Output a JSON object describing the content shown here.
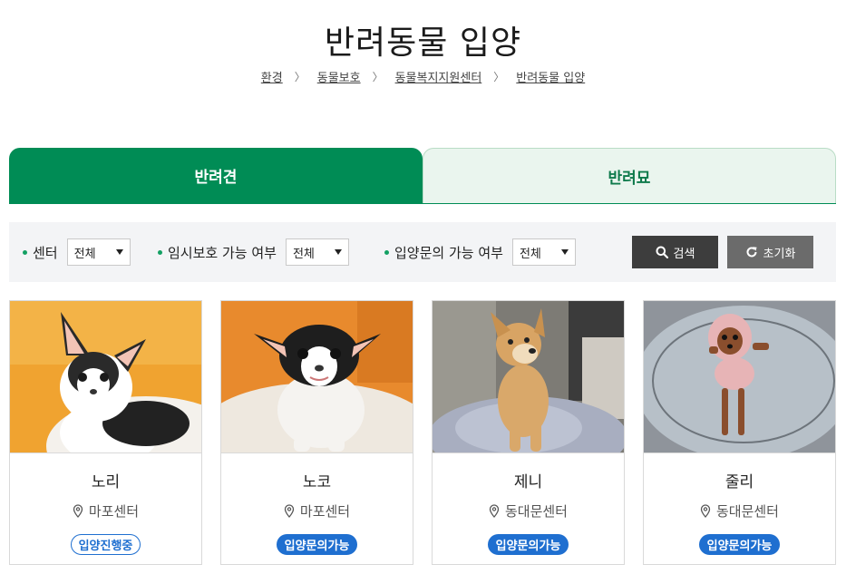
{
  "page": {
    "title": "반려동물 입양"
  },
  "breadcrumb": [
    "환경",
    "동물보호",
    "동물복지지원센터",
    "반려동물 입양"
  ],
  "tabs": [
    {
      "label": "반려견",
      "active": true
    },
    {
      "label": "반려묘",
      "active": false
    }
  ],
  "filters": [
    {
      "label": "센터",
      "value": "전체"
    },
    {
      "label": "임시보호 가능 여부",
      "value": "전체"
    },
    {
      "label": "입양문의 가능 여부",
      "value": "전체"
    }
  ],
  "buttons": {
    "search": "검색",
    "reset": "초기화"
  },
  "animals": [
    {
      "name": "노리",
      "center": "마포센터",
      "status": "입양진행중",
      "status_type": "ongoing"
    },
    {
      "name": "노코",
      "center": "마포센터",
      "status": "입양문의가능",
      "status_type": "available"
    },
    {
      "name": "제니",
      "center": "동대문센터",
      "status": "입양문의가능",
      "status_type": "available"
    },
    {
      "name": "줄리",
      "center": "동대문센터",
      "status": "입양문의가능",
      "status_type": "available"
    }
  ],
  "colors": {
    "primary_green": "#008c55",
    "tab_inactive_bg": "#eaf5ee",
    "badge_blue": "#1f6fd0",
    "search_btn": "#3d3d3d",
    "reset_btn": "#6b6b6b"
  }
}
